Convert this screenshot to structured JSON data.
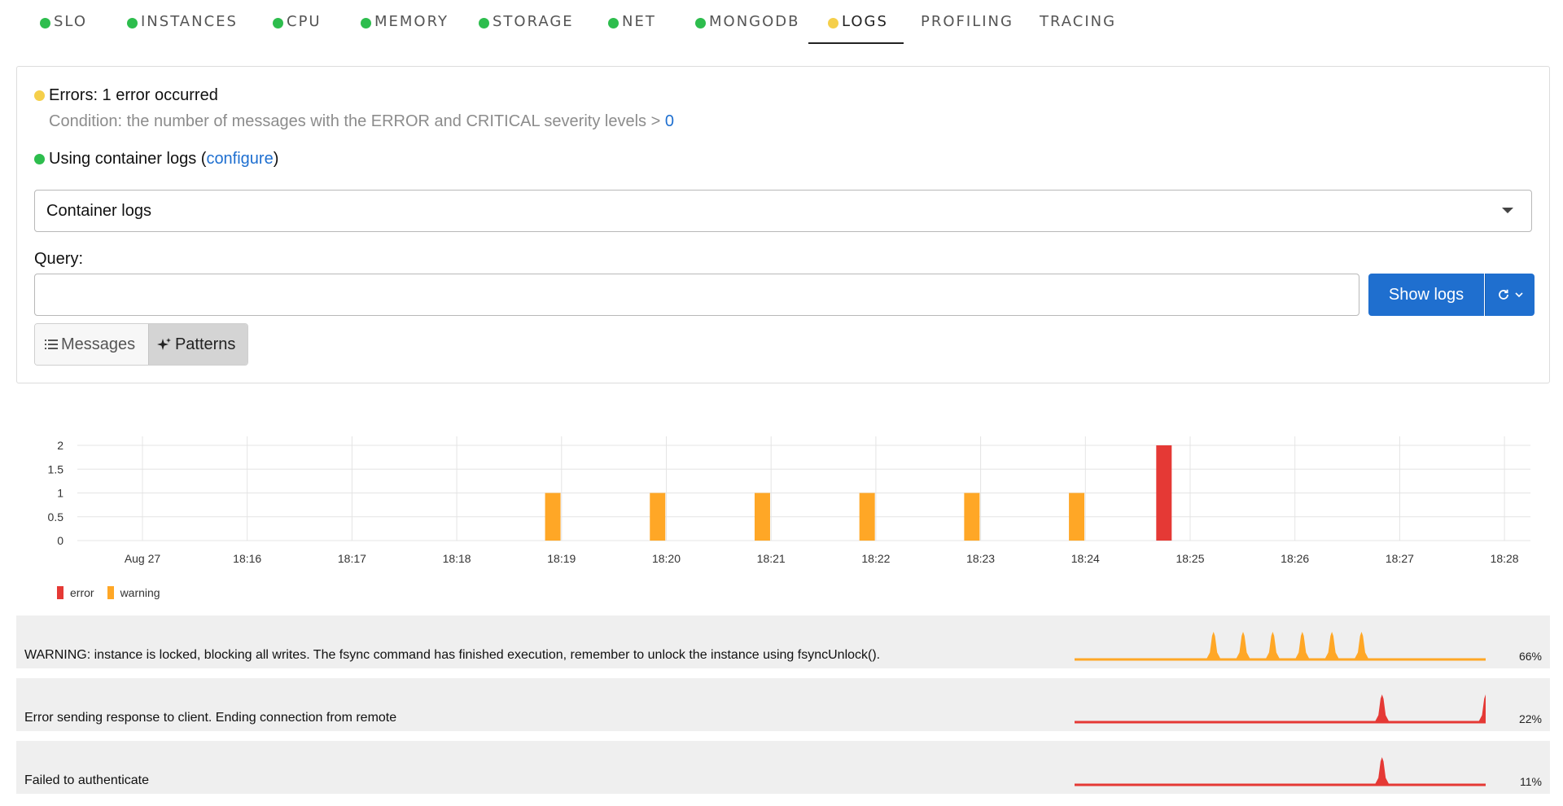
{
  "colors": {
    "ok": "#2dbd4d",
    "warn": "#f5cf4a",
    "error_series": "#e53935",
    "warning_series": "#ffa726",
    "primary": "#1f6fcf",
    "grid": "#e4e4e4"
  },
  "tabs": [
    {
      "label": "SLO",
      "status": "ok"
    },
    {
      "label": "INSTANCES",
      "status": "ok"
    },
    {
      "label": "CPU",
      "status": "ok"
    },
    {
      "label": "MEMORY",
      "status": "ok"
    },
    {
      "label": "STORAGE",
      "status": "ok"
    },
    {
      "label": "NET",
      "status": "ok"
    },
    {
      "label": "MONGODB",
      "status": "ok"
    },
    {
      "label": "LOGS",
      "status": "warn",
      "active": true
    },
    {
      "label": "PROFILING",
      "status": "none"
    },
    {
      "label": "TRACING",
      "status": "none"
    }
  ],
  "check": {
    "title": "Errors: 1 error occurred",
    "condition_text": "Condition: the number of messages with the ERROR and CRITICAL severity levels > ",
    "condition_value": "0"
  },
  "source": {
    "text": "Using container logs (",
    "link": "configure",
    "close": ")"
  },
  "select": {
    "value": "Container logs"
  },
  "query": {
    "label": "Query:",
    "value": "",
    "placeholder": ""
  },
  "buttons": {
    "show_logs": "Show logs",
    "refresh_icon": "refresh-icon"
  },
  "view_toggle": {
    "messages": "Messages",
    "patterns": "Patterns",
    "selected": "Patterns"
  },
  "chart_data": {
    "type": "bar",
    "stacked": true,
    "categories": [
      "Aug 27",
      "18:16",
      "18:17",
      "18:18",
      "18:19",
      "18:20",
      "18:21",
      "18:22",
      "18:23",
      "18:24",
      "18:25",
      "18:26",
      "18:27",
      "18:28"
    ],
    "y_ticks": [
      "0",
      "0.5",
      "1",
      "1.5",
      "2"
    ],
    "ylim": [
      0,
      2
    ],
    "grid": true,
    "series": [
      {
        "name": "error",
        "color": "#e53935",
        "points": [
          {
            "x": "18:24:45",
            "value": 2
          }
        ]
      },
      {
        "name": "warning",
        "color": "#ffa726",
        "points": [
          {
            "x": "18:18:55",
            "value": 1
          },
          {
            "x": "18:19:55",
            "value": 1
          },
          {
            "x": "18:20:55",
            "value": 1
          },
          {
            "x": "18:21:55",
            "value": 1
          },
          {
            "x": "18:22:55",
            "value": 1
          },
          {
            "x": "18:23:55",
            "value": 1
          }
        ]
      }
    ],
    "legend": [
      "error",
      "warning"
    ],
    "legend_position": "bottom-left"
  },
  "patterns": [
    {
      "message": "WARNING: instance is locked, blocking all writes. The fsync command has finished execution, remember to unlock the instance using fsyncUnlock().",
      "percent": "66%",
      "color": "#ffa726",
      "peaks": [
        0.338,
        0.41,
        0.482,
        0.554,
        0.626,
        0.698
      ],
      "peak_heights": [
        1,
        1,
        1,
        1,
        1,
        1
      ]
    },
    {
      "message": "Error sending response to client. Ending connection from remote",
      "percent": "22%",
      "color": "#e53935",
      "peaks": [
        0.748,
        1.0
      ],
      "peak_heights": [
        1,
        1
      ]
    },
    {
      "message": "Failed to authenticate",
      "percent": "11%",
      "color": "#e53935",
      "peaks": [
        0.748
      ],
      "peak_heights": [
        1
      ]
    }
  ]
}
